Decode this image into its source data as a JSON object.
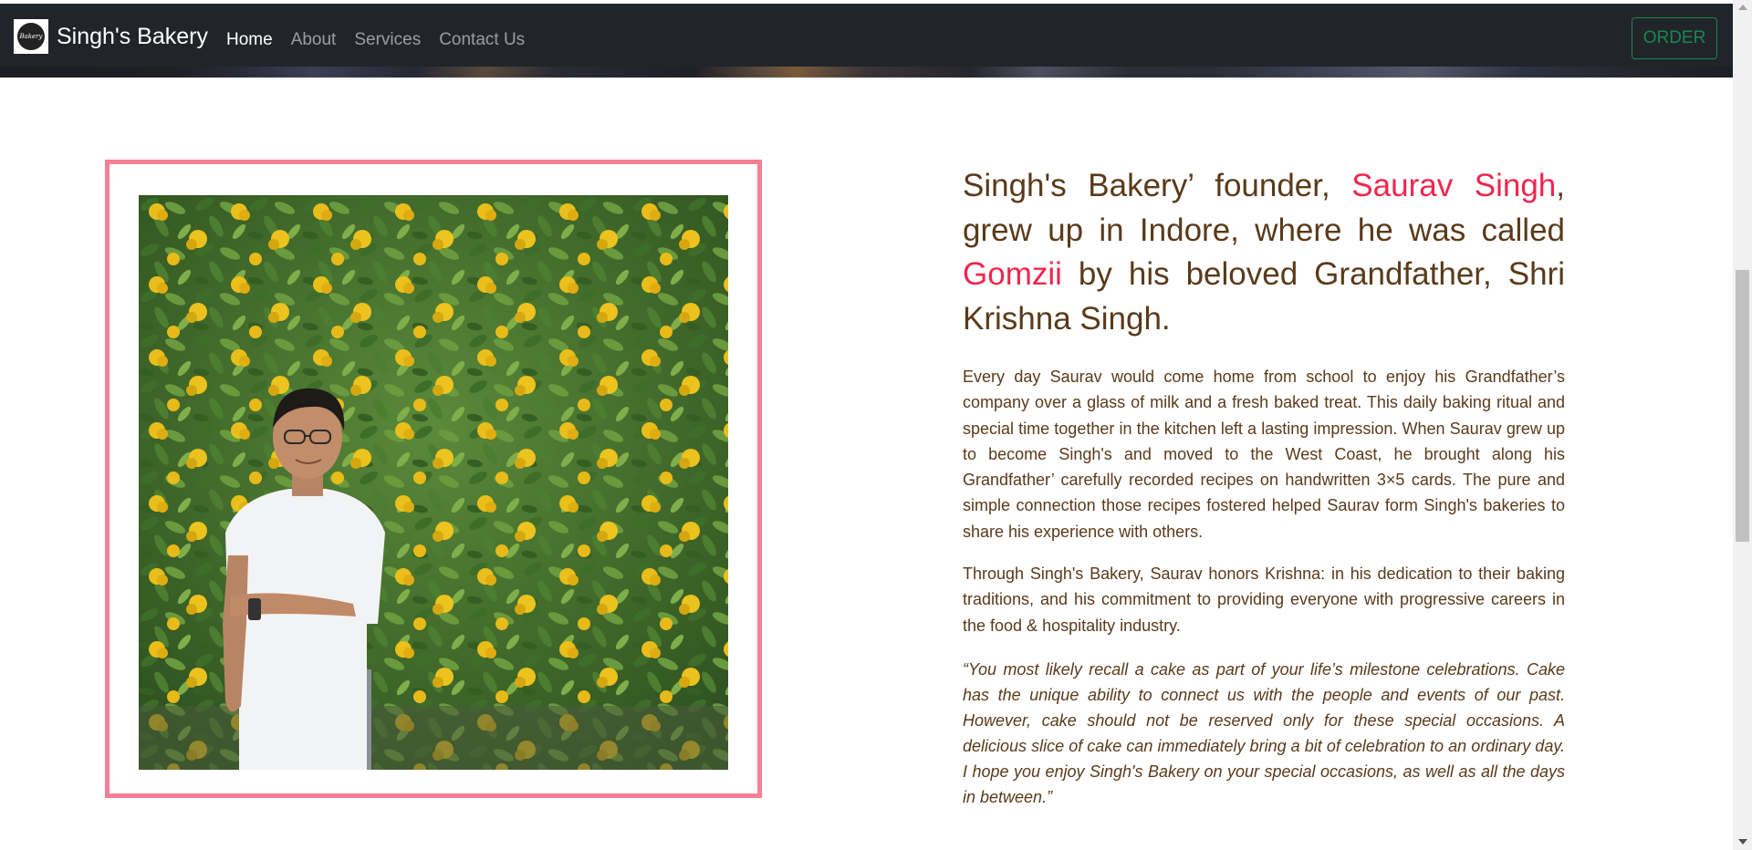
{
  "navbar": {
    "brand_name": "Singh's Bakery",
    "logo_text": "Bakery",
    "links": [
      {
        "label": "Home",
        "active": true
      },
      {
        "label": "About",
        "active": false
      },
      {
        "label": "Services",
        "active": false
      },
      {
        "label": "Contact Us",
        "active": false
      }
    ],
    "order_label": "ORDER"
  },
  "about": {
    "headline_part1": "Singh's Bakery’ founder, ",
    "headline_name": "Saurav Singh",
    "headline_part2": ", grew up in Indore, where he was called ",
    "headline_nickname": "Gomzii",
    "headline_part3": " by his beloved Grandfather, Shri Krishna Singh.",
    "paragraph1": "Every day Saurav would come home from school to enjoy his Grandfather’s company over a glass of milk and a fresh baked treat. This daily baking ritual and special time together in the kitchen left a lasting impression. When Saurav grew up to become Singh's and moved to the West Coast, he brought along his Grandfather’ carefully recorded recipes on handwritten 3×5 cards. The pure and simple connection those recipes fostered helped Saurav form Singh's bakeries to share his experience with others.",
    "paragraph2": "Through Singh's Bakery, Saurav honors Krishna: in his dedication to their baking traditions, and his commitment to providing everyone with progressive careers in the food & hospitality industry.",
    "quote": "“You most likely recall a cake as part of your life’s milestone celebrations. Cake has the unique ability to connect us with the people and events of our past. However, cake should not be reserved only for these special occasions. A delicious slice of cake can immediately bring a bit of celebration to an ordinary day. I hope you enjoy Singh's Bakery on your special occasions, as well as all the days in between.”"
  },
  "colors": {
    "navbar_bg": "#212529",
    "accent_pink": "#f0264e",
    "frame_pink": "#f77f95",
    "text_brown": "#5a3a1a",
    "order_green": "#198754"
  }
}
